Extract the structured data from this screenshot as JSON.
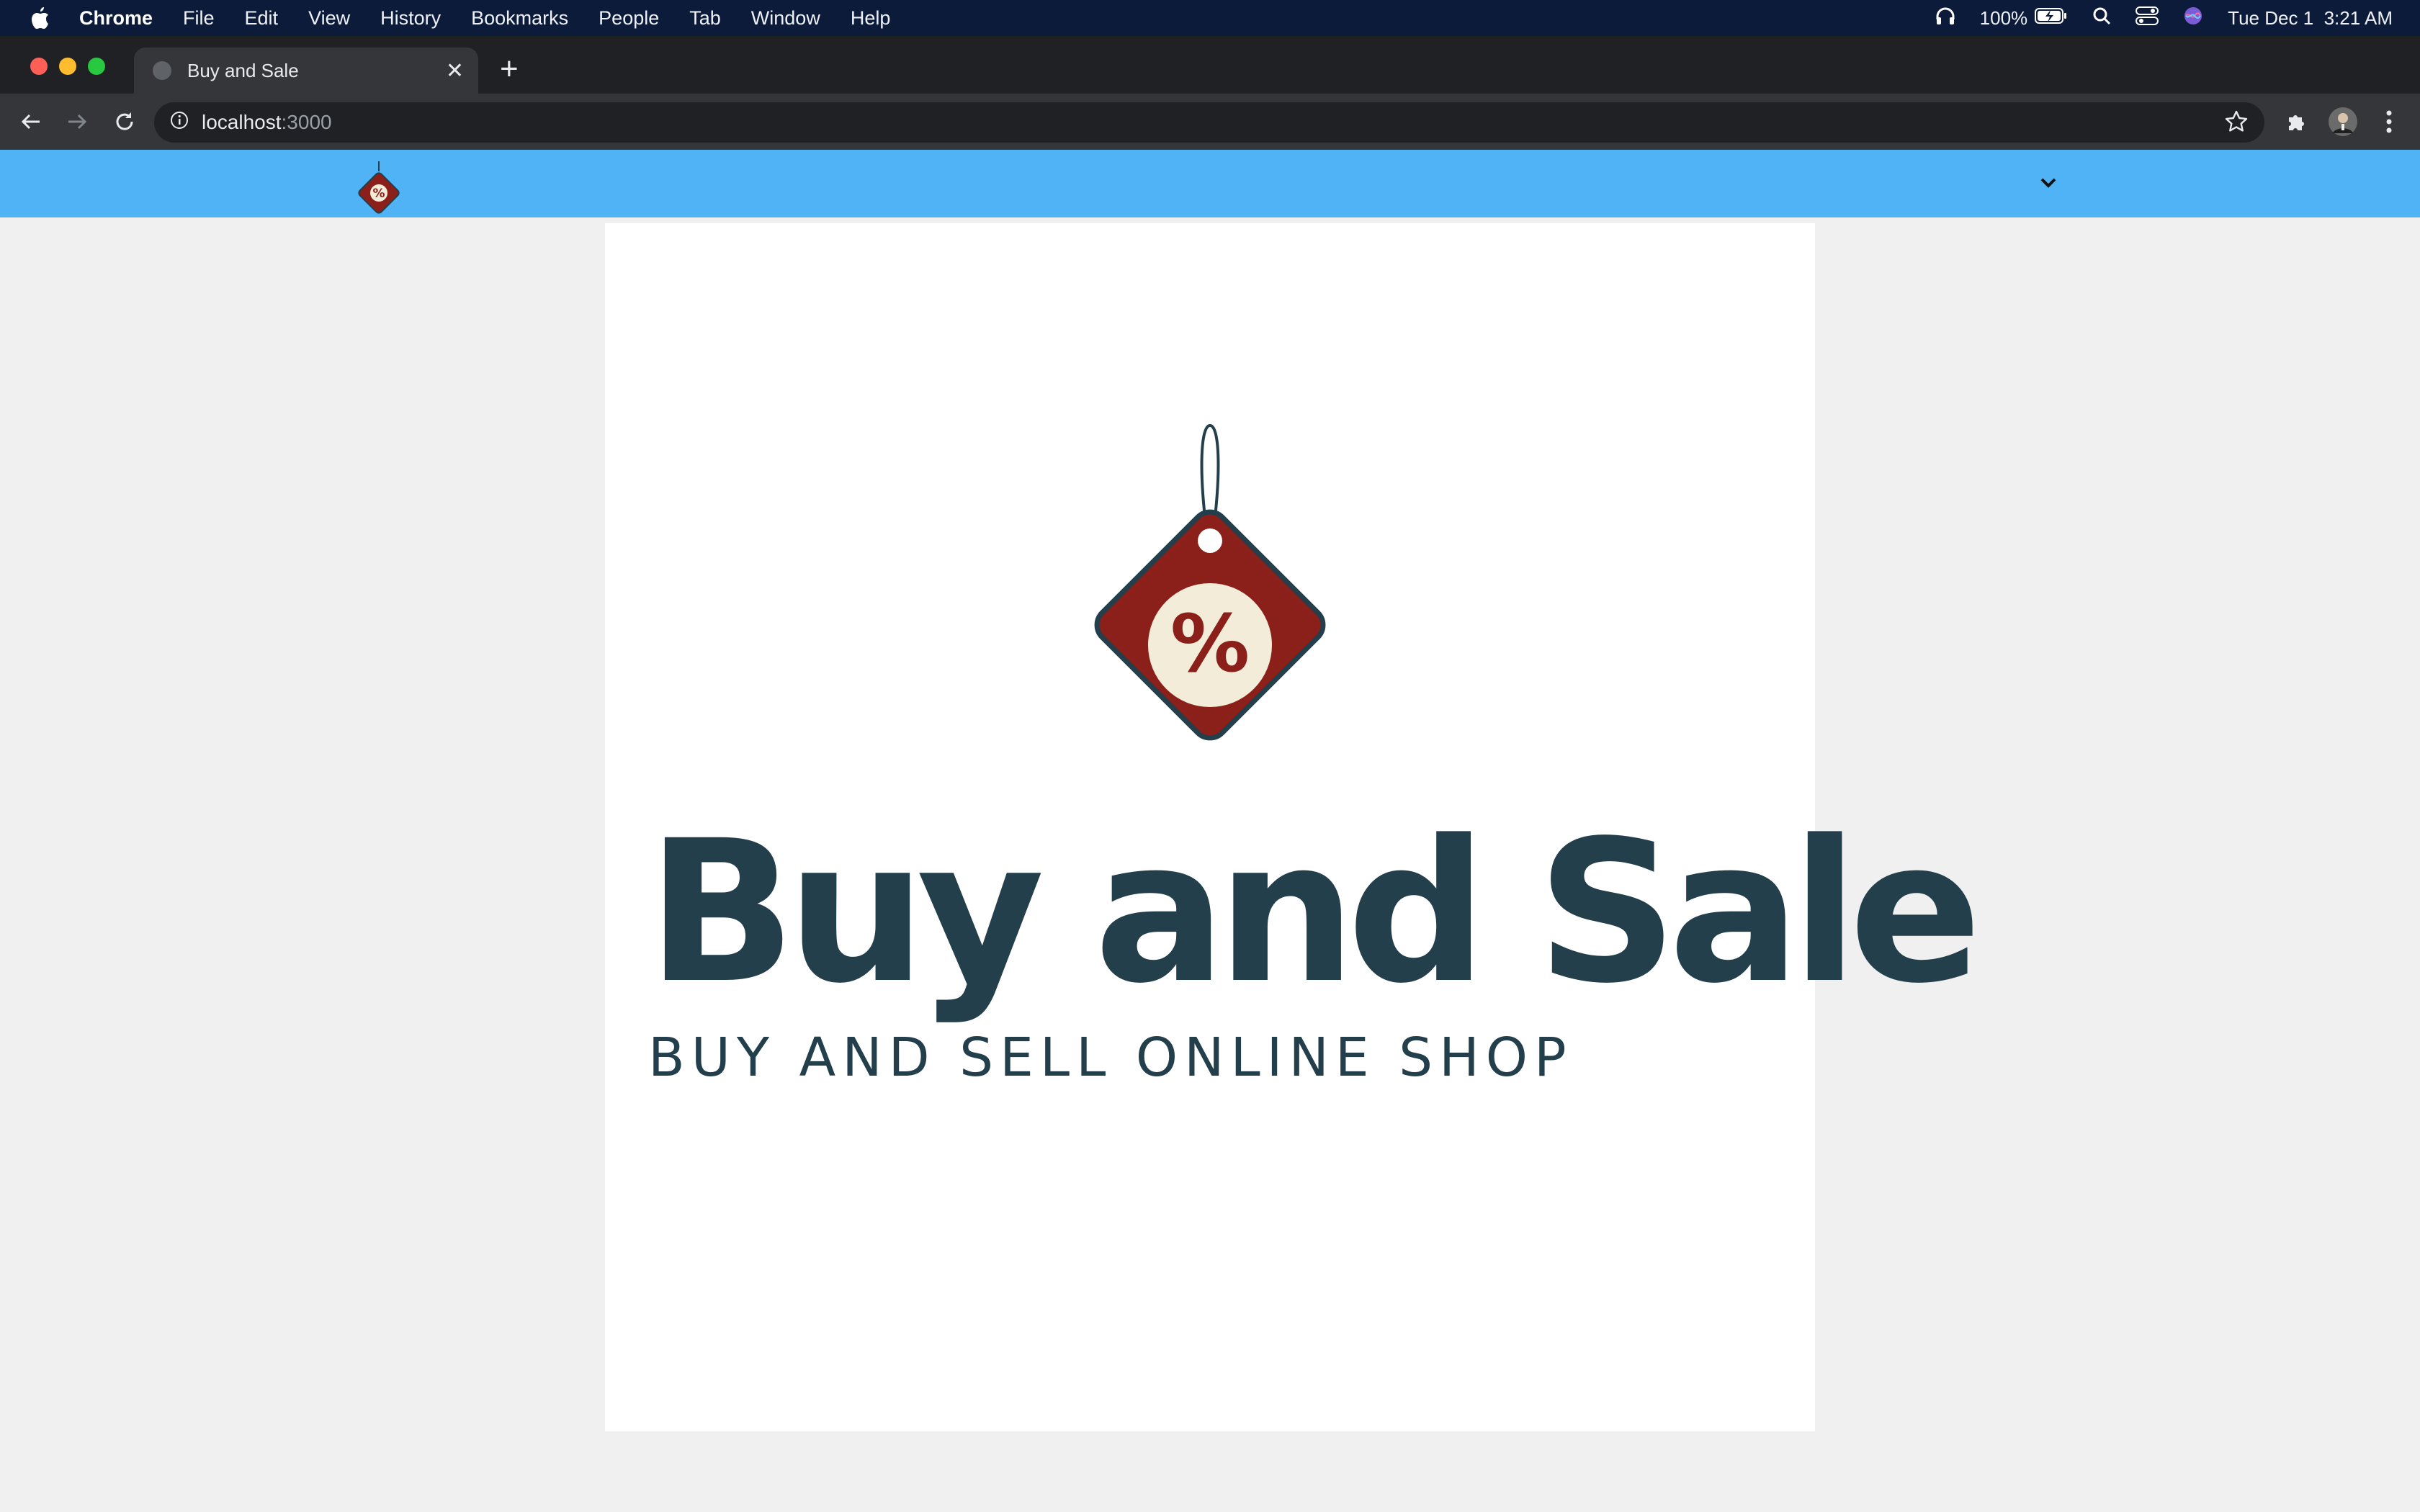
{
  "menubar": {
    "app_name": "Chrome",
    "items": [
      "File",
      "Edit",
      "View",
      "History",
      "Bookmarks",
      "People",
      "Tab",
      "Window",
      "Help"
    ],
    "battery": "100%",
    "datetime": "Tue Dec 1  3:21 AM"
  },
  "browser": {
    "tab_title": "Buy and Sale",
    "url_host": "localhost",
    "url_port": ":3000",
    "colors": {
      "close": "#ff5f57",
      "minimize": "#febc2e",
      "maximize": "#28c840"
    }
  },
  "site": {
    "header_color": "#4fb3f6",
    "brand_title": "Buy and Sale",
    "brand_subtitle": "BUY AND SELL ONLINE SHOP",
    "logo_symbol": "%",
    "colors": {
      "tag": "#8b1f1a",
      "text": "#233f4c",
      "circle": "#f3ecd8"
    }
  }
}
